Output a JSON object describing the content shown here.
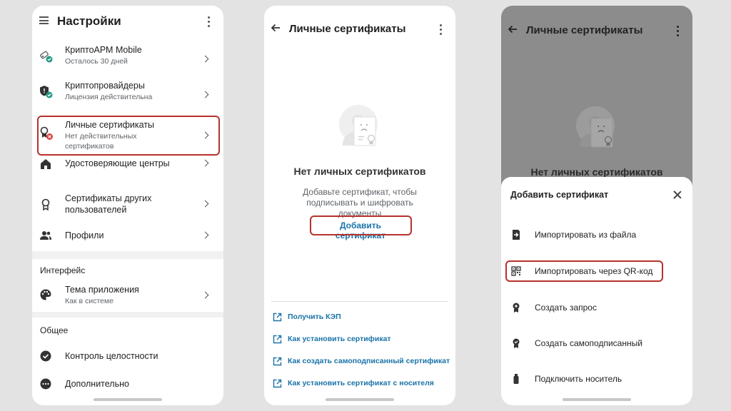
{
  "settings": {
    "title": "Настройки",
    "items": [
      {
        "title": "КриптоАРМ Mobile",
        "subtitle": "Осталось 30 дней"
      },
      {
        "title": "Криптопровайдеры",
        "subtitle": "Лицензия действительна"
      },
      {
        "title": "Личные сертификаты",
        "subtitle": "Нет действительных сертификатов"
      },
      {
        "title": "Удостоверяющие центры"
      },
      {
        "title": "Сертификаты других пользователей"
      },
      {
        "title": "Профили"
      }
    ],
    "interface_header": "Интерфейс",
    "theme": {
      "title": "Тема приложения",
      "subtitle": "Как в системе"
    },
    "general_header": "Общее",
    "general_items": [
      {
        "title": "Контроль целостности"
      },
      {
        "title": "Дополнительно"
      }
    ]
  },
  "certs": {
    "title": "Личные сертификаты",
    "empty_title": "Нет личных сертификатов",
    "empty_desc": "Добавьте сертификат, чтобы подписывать и шифровать документы",
    "add_label": "Добавить сертификат",
    "links": [
      "Получить КЭП",
      "Как установить сертификат",
      "Как создать самоподписанный сертификат",
      "Как установить сертификат с носителя"
    ]
  },
  "sheet": {
    "title": "Добавить сертификат",
    "items": [
      "Импортировать из файла",
      "Импортировать через QR-код",
      "Создать запрос",
      "Создать самоподписанный",
      "Подключить носитель"
    ]
  },
  "colors": {
    "accent": "#1a73a8",
    "highlight": "#b7312c",
    "ok": "#1e9a82",
    "error": "#d9463e"
  }
}
